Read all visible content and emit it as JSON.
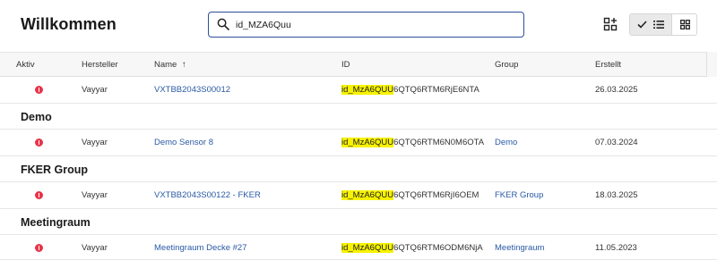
{
  "header": {
    "title": "Willkommen",
    "search": {
      "value": "id_MZA6Quu",
      "placeholder": ""
    }
  },
  "columns": {
    "aktiv": "Aktiv",
    "hersteller": "Hersteller",
    "name": "Name",
    "name_sort_icon": "↑",
    "id": "ID",
    "group": "Group",
    "erstellt": "Erstellt"
  },
  "rows": [
    {
      "hersteller": "Vayyar",
      "name": "VXTBB2043S00012",
      "id_match": "id_MzA6QUU",
      "id_rest": "6QTQ6RTM6RjE6NTA",
      "group": "",
      "erstellt": "26.03.2025"
    }
  ],
  "groups": [
    {
      "title": "Demo",
      "rows": [
        {
          "hersteller": "Vayyar",
          "name": "Demo Sensor 8",
          "id_match": "id_MzA6QUU",
          "id_rest": "6QTQ6RTM6N0M6OTA",
          "group": "Demo",
          "erstellt": "07.03.2024"
        }
      ]
    },
    {
      "title": "FKER Group",
      "rows": [
        {
          "hersteller": "Vayyar",
          "name": "VXTBB2043S00122 - FKER",
          "id_match": "id_MzA6QUU",
          "id_rest": "6QTQ6RTM6RjI6OEM",
          "group": "FKER Group",
          "erstellt": "18.03.2025"
        }
      ]
    },
    {
      "title": "Meetingraum",
      "rows": [
        {
          "hersteller": "Vayyar",
          "name": "Meetingraum Decke #27",
          "id_match": "id_MzA6QUU",
          "id_rest": "6QTQ6RTM6ODM6NjA",
          "group": "Meetingraum",
          "erstellt": "11.05.2023"
        }
      ]
    }
  ],
  "icons": {
    "search": "search-icon",
    "add_widget": "grid-add-icon",
    "checkmark": "check-icon",
    "list_view": "list-view-icon",
    "grid_view": "grid-view-icon",
    "status": "status-alert-icon"
  },
  "colors": {
    "link": "#2a5aa6",
    "highlight": "#f7f200",
    "status_error": "#e8344a",
    "search_border": "#2c4f9a"
  }
}
